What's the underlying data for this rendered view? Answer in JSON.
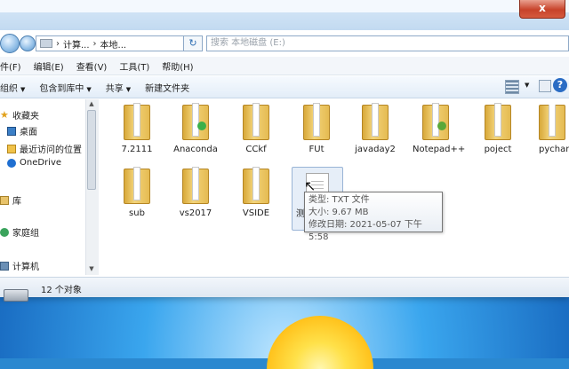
{
  "window": {
    "close_label": "x"
  },
  "address": {
    "crumbs": [
      "计算...",
      "本地..."
    ],
    "search_placeholder": "搜索 本地磁盘 (E:)"
  },
  "menu": {
    "items": [
      "件(F)",
      "编辑(E)",
      "查看(V)",
      "工具(T)",
      "帮助(H)"
    ]
  },
  "toolbar": {
    "items": [
      "组织",
      "包含到库中",
      "共享",
      "新建文件夹"
    ]
  },
  "nav": {
    "items": [
      "收藏夹",
      "桌面",
      "最近访问的位置",
      "OneDrive",
      "库",
      "家庭组",
      "计算机"
    ]
  },
  "files": {
    "row1": [
      "7.2111",
      "Anaconda",
      "CCkf",
      "FUt",
      "javaday2",
      "Notepad++",
      "poject",
      "pycharm"
    ],
    "row2": [
      "sub",
      "vs2017",
      "VSIDE"
    ],
    "selected_partial_name": "测"
  },
  "tooltip": {
    "type_line": "类型: TXT 文件",
    "size_line": "大小: 9.67 MB",
    "date_line": "修改日期: 2021-05-07 下午 5:58"
  },
  "status": {
    "count": "12 个对象"
  },
  "colors": {
    "accent": "#2a6cc4",
    "folder": "#f3d47b",
    "close": "#c7432a"
  }
}
